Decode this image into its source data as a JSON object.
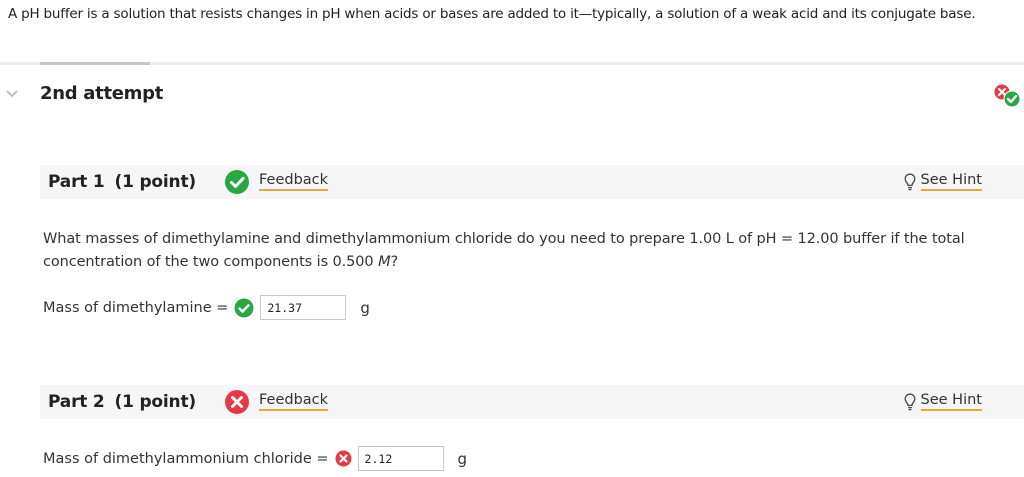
{
  "intro_text": "A pH buffer is a solution that resists changes in pH when acids or bases are added to it—typically, a solution of a weak acid and its conjugate base.",
  "attempt": {
    "title": "2nd attempt"
  },
  "parts": [
    {
      "label": "Part 1",
      "points": "(1 point)",
      "status": "correct",
      "feedback_label": "Feedback",
      "hint_label": "See Hint"
    },
    {
      "label": "Part 2",
      "points": "(1 point)",
      "status": "incorrect",
      "feedback_label": "Feedback",
      "hint_label": "See Hint"
    }
  ],
  "question": {
    "text_before_unit": "What masses of dimethylamine and dimethylammonium chloride do you need to prepare 1.00 L of pH = 12.00 buffer if the total concentration of the two components is 0.500 ",
    "unit_italic": "M",
    "text_after_unit": "?"
  },
  "answers": [
    {
      "label": "Mass of dimethylamine =",
      "value": "21.37",
      "unit": "g",
      "status": "correct"
    },
    {
      "label": "Mass of dimethylammonium chloride =",
      "value": "2.12",
      "unit": "g",
      "status": "incorrect"
    }
  ],
  "colors": {
    "correct": "#27a844",
    "incorrect": "#e63946",
    "link_underline": "#e8a33c",
    "part_bar": "#f6f6f6"
  }
}
